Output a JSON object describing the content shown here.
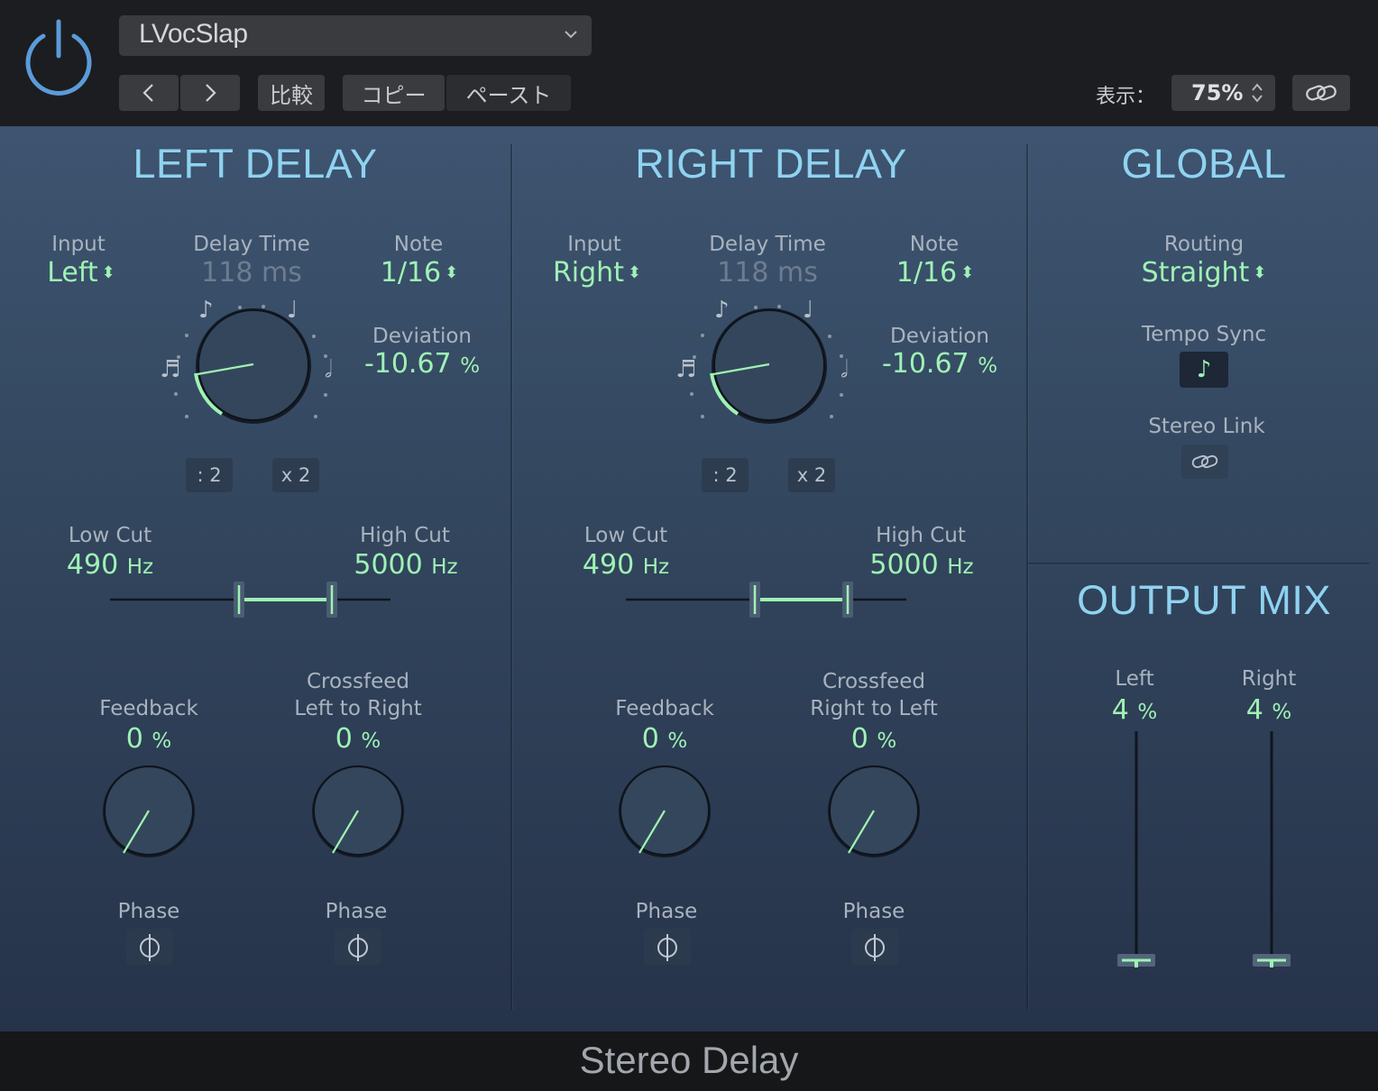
{
  "header": {
    "preset_name": "LVocSlap",
    "prev_label": "<",
    "next_label": ">",
    "compare_label": "比較",
    "copy_label": "コピー",
    "paste_label": "ペースト",
    "view_label": "表示：",
    "zoom_value": "75%"
  },
  "left_delay": {
    "title": "LEFT DELAY",
    "input_label": "Input",
    "input_value": "Left",
    "delay_time_label": "Delay Time",
    "delay_time_value": "118 ms",
    "note_label": "Note",
    "note_value": "1/16",
    "deviation_label": "Deviation",
    "deviation_value": "-10.67",
    "deviation_unit": "%",
    "half_label": ": 2",
    "double_label": "x 2",
    "low_cut_label": "Low Cut",
    "low_cut_value": "490",
    "low_cut_unit": "Hz",
    "high_cut_label": "High Cut",
    "high_cut_value": "5000",
    "high_cut_unit": "Hz",
    "feedback_label": "Feedback",
    "feedback_value": "0",
    "feedback_unit": "%",
    "crossfeed_label_1": "Crossfeed",
    "crossfeed_label_2": "Left to Right",
    "crossfeed_value": "0",
    "crossfeed_unit": "%",
    "phase_label_1": "Phase",
    "phase_label_2": "Phase"
  },
  "right_delay": {
    "title": "RIGHT DELAY",
    "input_label": "Input",
    "input_value": "Right",
    "delay_time_label": "Delay Time",
    "delay_time_value": "118 ms",
    "note_label": "Note",
    "note_value": "1/16",
    "deviation_label": "Deviation",
    "deviation_value": "-10.67",
    "deviation_unit": "%",
    "half_label": ": 2",
    "double_label": "x 2",
    "low_cut_label": "Low Cut",
    "low_cut_value": "490",
    "low_cut_unit": "Hz",
    "high_cut_label": "High Cut",
    "high_cut_value": "5000",
    "high_cut_unit": "Hz",
    "feedback_label": "Feedback",
    "feedback_value": "0",
    "feedback_unit": "%",
    "crossfeed_label_1": "Crossfeed",
    "crossfeed_label_2": "Right to Left",
    "crossfeed_value": "0",
    "crossfeed_unit": "%",
    "phase_label_1": "Phase",
    "phase_label_2": "Phase"
  },
  "global": {
    "title": "GLOBAL",
    "routing_label": "Routing",
    "routing_value": "Straight",
    "tempo_sync_label": "Tempo Sync",
    "stereo_link_label": "Stereo Link"
  },
  "output_mix": {
    "title": "OUTPUT MIX",
    "left_label": "Left",
    "left_value": "4",
    "left_unit": "%",
    "right_label": "Right",
    "right_value": "4",
    "right_unit": "%"
  },
  "footer": {
    "plugin_name": "Stereo Delay"
  },
  "colors": {
    "accent_green": "#9ef2b4",
    "title_blue": "#8fd3f0",
    "power_blue": "#5b9bd9"
  },
  "icons": [
    "power-icon",
    "chevron-down-icon",
    "chevron-left-icon",
    "chevron-right-icon",
    "link-icon",
    "eighth-note-icon",
    "phase-icon",
    "up-down-arrows-icon"
  ]
}
